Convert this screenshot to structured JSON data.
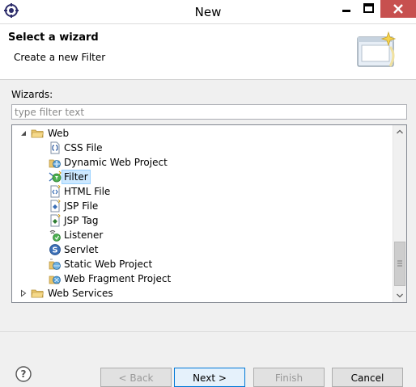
{
  "window": {
    "title": "New"
  },
  "header": {
    "title": "Select a wizard",
    "description": "Create a new Filter"
  },
  "wizards": {
    "label": "Wizards:",
    "filter_placeholder": "type filter text",
    "tree": {
      "web": {
        "label": "Web",
        "expanded": true,
        "children": [
          {
            "label": "CSS File",
            "icon": "css-file-icon"
          },
          {
            "label": "Dynamic Web Project",
            "icon": "dynamic-web-project-icon"
          },
          {
            "label": "Filter",
            "icon": "filter-icon",
            "selected": true
          },
          {
            "label": "HTML File",
            "icon": "html-file-icon"
          },
          {
            "label": "JSP File",
            "icon": "jsp-file-icon"
          },
          {
            "label": "JSP Tag",
            "icon": "jsp-tag-icon"
          },
          {
            "label": "Listener",
            "icon": "listener-icon"
          },
          {
            "label": "Servlet",
            "icon": "servlet-icon"
          },
          {
            "label": "Static Web Project",
            "icon": "static-web-project-icon"
          },
          {
            "label": "Web Fragment Project",
            "icon": "web-fragment-project-icon"
          }
        ]
      },
      "web_services": {
        "label": "Web Services",
        "expanded": false
      }
    }
  },
  "footer": {
    "back_label": "< Back",
    "next_label": "Next >",
    "finish_label": "Finish",
    "cancel_label": "Cancel"
  },
  "colors": {
    "selection": "#cce8ff",
    "close_button": "#c7504f",
    "accent": "#0078d7"
  }
}
